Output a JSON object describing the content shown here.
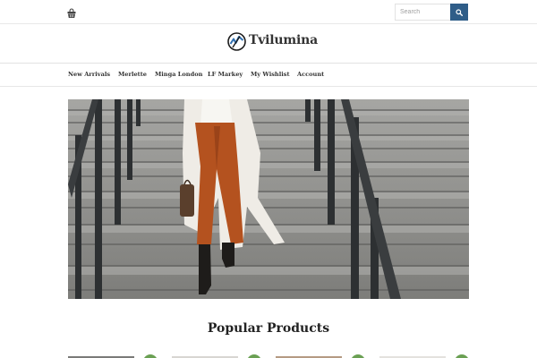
{
  "topbar": {
    "cart_icon": "basket-icon",
    "search": {
      "placeholder": "Search",
      "button_icon": "search-icon"
    }
  },
  "brand": {
    "logo_icon": "tvilumina-logo-icon",
    "site_name": "Tvilumina"
  },
  "nav": {
    "items": [
      {
        "label": "New Arrivals"
      },
      {
        "label": "Merlette"
      },
      {
        "label": "Minga London"
      },
      {
        "label": "LF Markey"
      },
      {
        "label": "My Wishlist"
      },
      {
        "label": "Account"
      }
    ]
  },
  "hero": {
    "image": "woman-walking-down-stairs"
  },
  "popular": {
    "title": "Popular Products",
    "products": [
      {
        "badge_icon": "wishlist-badge-icon"
      },
      {
        "badge_icon": "wishlist-badge-icon"
      },
      {
        "badge_icon": "wishlist-badge-icon"
      },
      {
        "badge_icon": "wishlist-badge-icon"
      }
    ]
  },
  "colors": {
    "accent": "#2f5d88",
    "badge": "#6aa053",
    "pants": "#b4521f"
  }
}
